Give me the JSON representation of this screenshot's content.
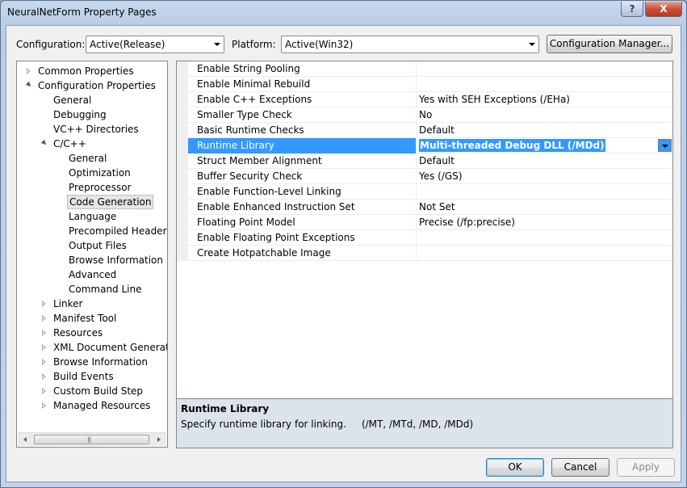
{
  "window": {
    "title": "NeuralNetForm Property Pages",
    "help_label": "?",
    "close_label": "X"
  },
  "toolbar": {
    "configuration_label": "Configuration:",
    "configuration_value": "Active(Release)",
    "platform_label": "Platform:",
    "platform_value": "Active(Win32)",
    "config_manager_label": "Configuration Manager..."
  },
  "tree": {
    "items": [
      {
        "label": "Common Properties",
        "state": "collapsed"
      },
      {
        "label": "Configuration Properties",
        "state": "expanded"
      },
      {
        "label": "General"
      },
      {
        "label": "Debugging"
      },
      {
        "label": "VC++ Directories"
      },
      {
        "label": "C/C++",
        "state": "expanded"
      },
      {
        "label": "General"
      },
      {
        "label": "Optimization"
      },
      {
        "label": "Preprocessor"
      },
      {
        "label": "Code Generation",
        "selected": true
      },
      {
        "label": "Language"
      },
      {
        "label": "Precompiled Headers"
      },
      {
        "label": "Output Files"
      },
      {
        "label": "Browse Information"
      },
      {
        "label": "Advanced"
      },
      {
        "label": "Command Line"
      },
      {
        "label": "Linker",
        "state": "collapsed"
      },
      {
        "label": "Manifest Tool",
        "state": "collapsed"
      },
      {
        "label": "Resources",
        "state": "collapsed"
      },
      {
        "label": "XML Document Generator",
        "state": "collapsed"
      },
      {
        "label": "Browse Information",
        "state": "collapsed"
      },
      {
        "label": "Build Events",
        "state": "collapsed"
      },
      {
        "label": "Custom Build Step",
        "state": "collapsed"
      },
      {
        "label": "Managed Resources",
        "state": "collapsed"
      }
    ],
    "scroll_grip": "|||"
  },
  "properties": [
    {
      "name": "Enable String Pooling",
      "value": ""
    },
    {
      "name": "Enable Minimal Rebuild",
      "value": ""
    },
    {
      "name": "Enable C++ Exceptions",
      "value": "Yes with SEH Exceptions (/EHa)"
    },
    {
      "name": "Smaller Type Check",
      "value": "No"
    },
    {
      "name": "Basic Runtime Checks",
      "value": "Default"
    },
    {
      "name": "Runtime Library",
      "value": "Multi-threaded Debug DLL (/MDd)",
      "selected": true
    },
    {
      "name": "Struct Member Alignment",
      "value": "Default"
    },
    {
      "name": "Buffer Security Check",
      "value": "Yes (/GS)"
    },
    {
      "name": "Enable Function-Level Linking",
      "value": ""
    },
    {
      "name": "Enable Enhanced Instruction Set",
      "value": "Not Set"
    },
    {
      "name": "Floating Point Model",
      "value": "Precise (/fp:precise)"
    },
    {
      "name": "Enable Floating Point Exceptions",
      "value": ""
    },
    {
      "name": "Create Hotpatchable Image",
      "value": ""
    }
  ],
  "description": {
    "title": "Runtime Library",
    "text": "Specify runtime library for linking.     (/MT, /MTd, /MD, /MDd)"
  },
  "footer": {
    "ok_label": "OK",
    "cancel_label": "Cancel",
    "apply_label": "Apply"
  }
}
